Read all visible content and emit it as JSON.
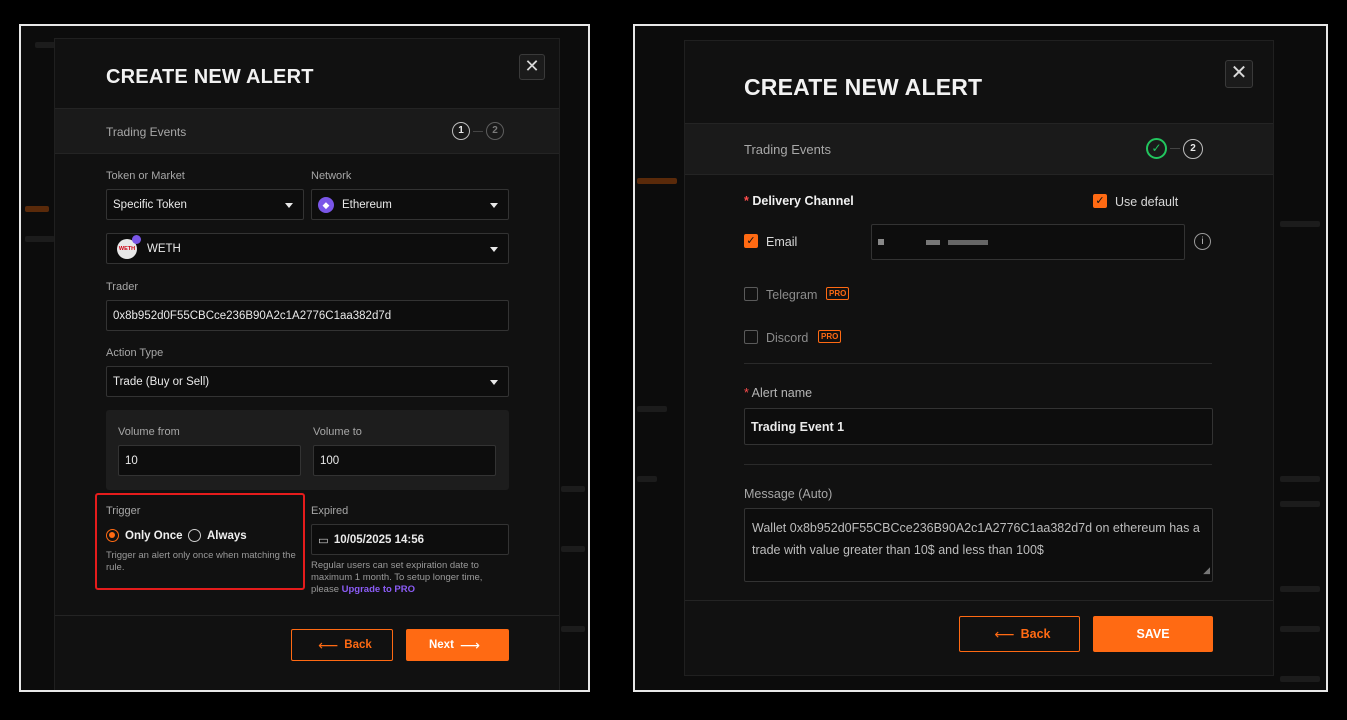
{
  "left": {
    "title": "CREATE NEW ALERT",
    "close_glyph": "✕",
    "step_label": "Trading Events",
    "steps": [
      "1",
      "2"
    ],
    "token_label": "Token or Market",
    "token_value": "Specific Token",
    "network_label": "Network",
    "network_value": "Ethereum",
    "network_icon": "ethereum-icon",
    "token_select_value": "WETH",
    "token_icon_text": "WETH",
    "trader_label": "Trader",
    "trader_value": "0x8b952d0F55CBCce236B90A2c1A2776C1aa382d7d",
    "action_label": "Action Type",
    "action_value": "Trade (Buy or Sell)",
    "volume_from_label": "Volume from",
    "volume_from_value": "10",
    "volume_to_label": "Volume to",
    "volume_to_value": "100",
    "trigger_label": "Trigger",
    "trigger_options": [
      "Only Once",
      "Always"
    ],
    "trigger_selected": "Only Once",
    "trigger_hint": "Trigger an alert only once when matching the rule.",
    "expired_label": "Expired",
    "expired_value": "10/05/2025 14:56",
    "expired_hint": "Regular users can set expiration date to maximum 1 month. To setup longer time, please",
    "upgrade_link": "Upgrade to PRO",
    "back_label": "Back",
    "next_label": "Next",
    "accent_color": "#ff6a13"
  },
  "right": {
    "title": "CREATE NEW ALERT",
    "close_glyph": "✕",
    "step_label": "Trading Events",
    "steps": [
      "✓",
      "2"
    ],
    "delivery_label": "Delivery Channel",
    "use_default_label": "Use default",
    "email_label": "Email",
    "telegram_label": "Telegram",
    "discord_label": "Discord",
    "pro_tag": "PRO",
    "alert_name_label": "Alert name",
    "alert_name_value": "Trading Event 1",
    "message_label": "Message (Auto)",
    "message_value": "Wallet 0x8b952d0F55CBCce236B90A2c1A2776C1aa382d7d on ethereum has a trade with value greater than 10$ and less than 100$",
    "back_label": "Back",
    "save_label": "SAVE",
    "success_color": "#22c55e"
  }
}
